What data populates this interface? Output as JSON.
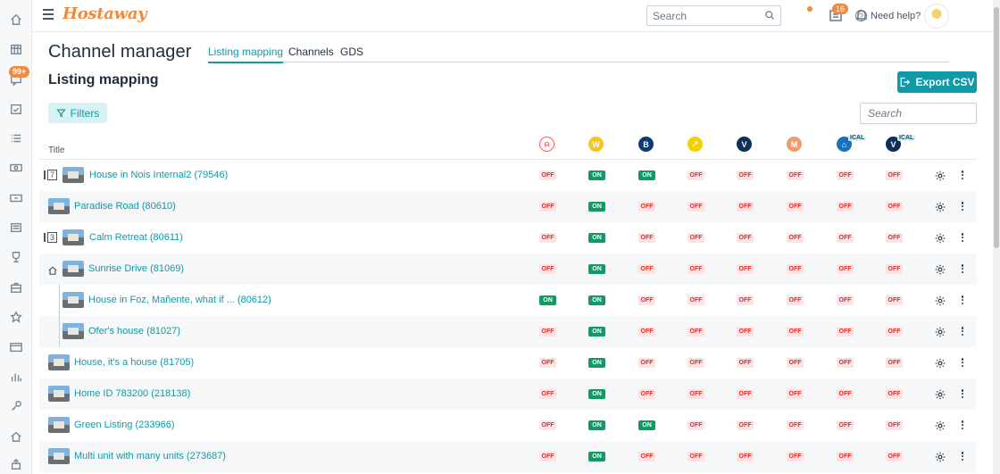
{
  "header": {
    "logo": "Hostaway",
    "search_placeholder": "Search",
    "notifications_count": "16",
    "help_label": "Need help?"
  },
  "sidebar": {
    "badge": "99+",
    "icons": [
      "home-icon",
      "calendar-grid-icon",
      "messages-icon",
      "calendar-check-icon",
      "list-icon",
      "money-icon",
      "payments-icon",
      "report-icon",
      "trophy-icon",
      "briefcase-icon",
      "star-icon",
      "card-icon",
      "chart-icon",
      "key-icon",
      "house-icon",
      "upload-icon"
    ]
  },
  "page": {
    "title": "Channel manager",
    "tabs": [
      {
        "label": "Listing mapping",
        "active": true
      },
      {
        "label": "Channels",
        "active": false
      },
      {
        "label": "GDS",
        "active": false
      }
    ],
    "section_title": "Listing mapping",
    "export_label": "Export CSV",
    "filters_label": "Filters",
    "table_search_placeholder": "Search"
  },
  "table": {
    "title_header": "Title",
    "channels": [
      {
        "name": "airbnb",
        "glyph": "⍝",
        "color": "#ff5a5f"
      },
      {
        "name": "w",
        "glyph": "W",
        "color": "#f5c518"
      },
      {
        "name": "booking",
        "glyph": "B",
        "color": "#0e3b73"
      },
      {
        "name": "arrow",
        "glyph": "↗",
        "color": "#f5d000"
      },
      {
        "name": "v",
        "glyph": "V",
        "color": "#0e2f5a"
      },
      {
        "name": "m",
        "glyph": "M",
        "color": "#f29a6a"
      },
      {
        "name": "home-ical",
        "glyph": "⌂",
        "color": "#1a73b8",
        "tag": "ICAL"
      },
      {
        "name": "v-ical",
        "glyph": "V",
        "color": "#0e2f5a",
        "tag": "ICAL"
      }
    ],
    "rows": [
      {
        "title": "House in Nois Internal2 (79546)",
        "kind": "group",
        "count": "7",
        "statuses": [
          "OFF",
          "ON",
          "ON",
          "OFF",
          "OFF",
          "OFF",
          "OFF",
          "OFF"
        ]
      },
      {
        "title": "Paradise Road (80610)",
        "kind": "plain",
        "statuses": [
          "OFF",
          "ON",
          "OFF",
          "OFF",
          "OFF",
          "OFF",
          "OFF",
          "OFF"
        ]
      },
      {
        "title": "Calm Retreat (80611)",
        "kind": "group",
        "count": "3",
        "statuses": [
          "OFF",
          "ON",
          "OFF",
          "OFF",
          "OFF",
          "OFF",
          "OFF",
          "OFF"
        ]
      },
      {
        "title": "Sunrise Drive (81069)",
        "kind": "home",
        "statuses": [
          "OFF",
          "ON",
          "OFF",
          "OFF",
          "OFF",
          "OFF",
          "OFF",
          "OFF"
        ]
      },
      {
        "title": "House in Foz, Mañente, what if ... (80612)",
        "kind": "child",
        "statuses": [
          "ON",
          "ON",
          "OFF",
          "OFF",
          "OFF",
          "OFF",
          "OFF",
          "OFF"
        ]
      },
      {
        "title": "Ofer's house (81027)",
        "kind": "child",
        "statuses": [
          "OFF",
          "ON",
          "OFF",
          "OFF",
          "OFF",
          "OFF",
          "OFF",
          "OFF"
        ]
      },
      {
        "title": "House, it's a house (81705)",
        "kind": "plain",
        "statuses": [
          "OFF",
          "ON",
          "OFF",
          "OFF",
          "OFF",
          "OFF",
          "OFF",
          "OFF"
        ]
      },
      {
        "title": "Home ID 783200 (218138)",
        "kind": "plain",
        "statuses": [
          "OFF",
          "ON",
          "OFF",
          "OFF",
          "OFF",
          "OFF",
          "OFF",
          "OFF"
        ]
      },
      {
        "title": "Green Listing (233966)",
        "kind": "plain",
        "statuses": [
          "OFF",
          "ON",
          "ON",
          "OFF",
          "OFF",
          "OFF",
          "OFF",
          "OFF"
        ]
      },
      {
        "title": "Multi unit with many units (273687)",
        "kind": "plain",
        "statuses": [
          "OFF",
          "ON",
          "OFF",
          "OFF",
          "OFF",
          "OFF",
          "OFF",
          "OFF"
        ]
      }
    ]
  }
}
